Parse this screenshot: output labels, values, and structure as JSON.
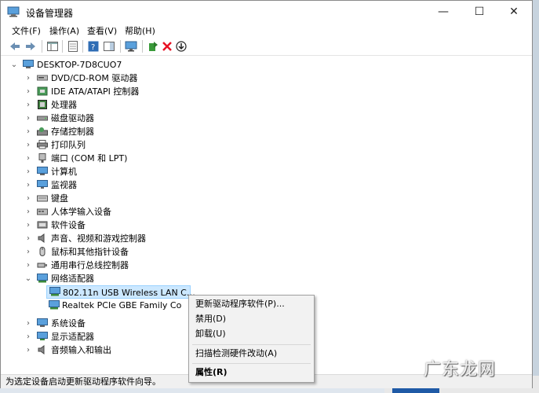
{
  "window": {
    "title": "设备管理器",
    "minimize": "—",
    "maximize": "☐",
    "close": "✕"
  },
  "menu": [
    "文件(F)",
    "操作(A)",
    "查看(V)",
    "帮助(H)"
  ],
  "tree": {
    "root": "DESKTOP-7D8CUO7",
    "categories": [
      {
        "label": "DVD/CD-ROM 驱动器",
        "icon": "dvd-icon"
      },
      {
        "label": "IDE ATA/ATAPI 控制器",
        "icon": "ide-controller-icon"
      },
      {
        "label": "处理器",
        "icon": "processor-icon"
      },
      {
        "label": "磁盘驱动器",
        "icon": "disk-drive-icon"
      },
      {
        "label": "存储控制器",
        "icon": "storage-controller-icon"
      },
      {
        "label": "打印队列",
        "icon": "printer-icon"
      },
      {
        "label": "端口 (COM 和 LPT)",
        "icon": "port-icon"
      },
      {
        "label": "计算机",
        "icon": "computer-icon"
      },
      {
        "label": "监视器",
        "icon": "monitor-icon"
      },
      {
        "label": "键盘",
        "icon": "keyboard-icon"
      },
      {
        "label": "人体学输入设备",
        "icon": "hid-icon"
      },
      {
        "label": "软件设备",
        "icon": "software-device-icon"
      },
      {
        "label": "声音、视频和游戏控制器",
        "icon": "sound-icon"
      },
      {
        "label": "鼠标和其他指针设备",
        "icon": "mouse-icon"
      },
      {
        "label": "通用串行总线控制器",
        "icon": "usb-icon"
      },
      {
        "label": "网络适配器",
        "icon": "network-adapter-icon",
        "expanded": true
      }
    ],
    "network_children": [
      "802.11n USB Wireless LAN C…",
      "Realtek PCIe GBE Family Co"
    ],
    "after": [
      {
        "label": "系统设备",
        "icon": "system-device-icon"
      },
      {
        "label": "显示适配器",
        "icon": "display-adapter-icon"
      },
      {
        "label": "音频输入和输出",
        "icon": "audio-io-icon"
      }
    ]
  },
  "context_menu": {
    "update": "更新驱动程序软件(P)...",
    "disable": "禁用(D)",
    "uninstall": "卸载(U)",
    "scan": "扫描检测硬件改动(A)",
    "properties": "属性(R)"
  },
  "status": "为选定设备启动更新驱动程序软件向导。",
  "watermark": "广东龙网",
  "colors": {
    "selection": "#cce8ff",
    "accent": "#0078d7",
    "delete": "#e81123"
  }
}
